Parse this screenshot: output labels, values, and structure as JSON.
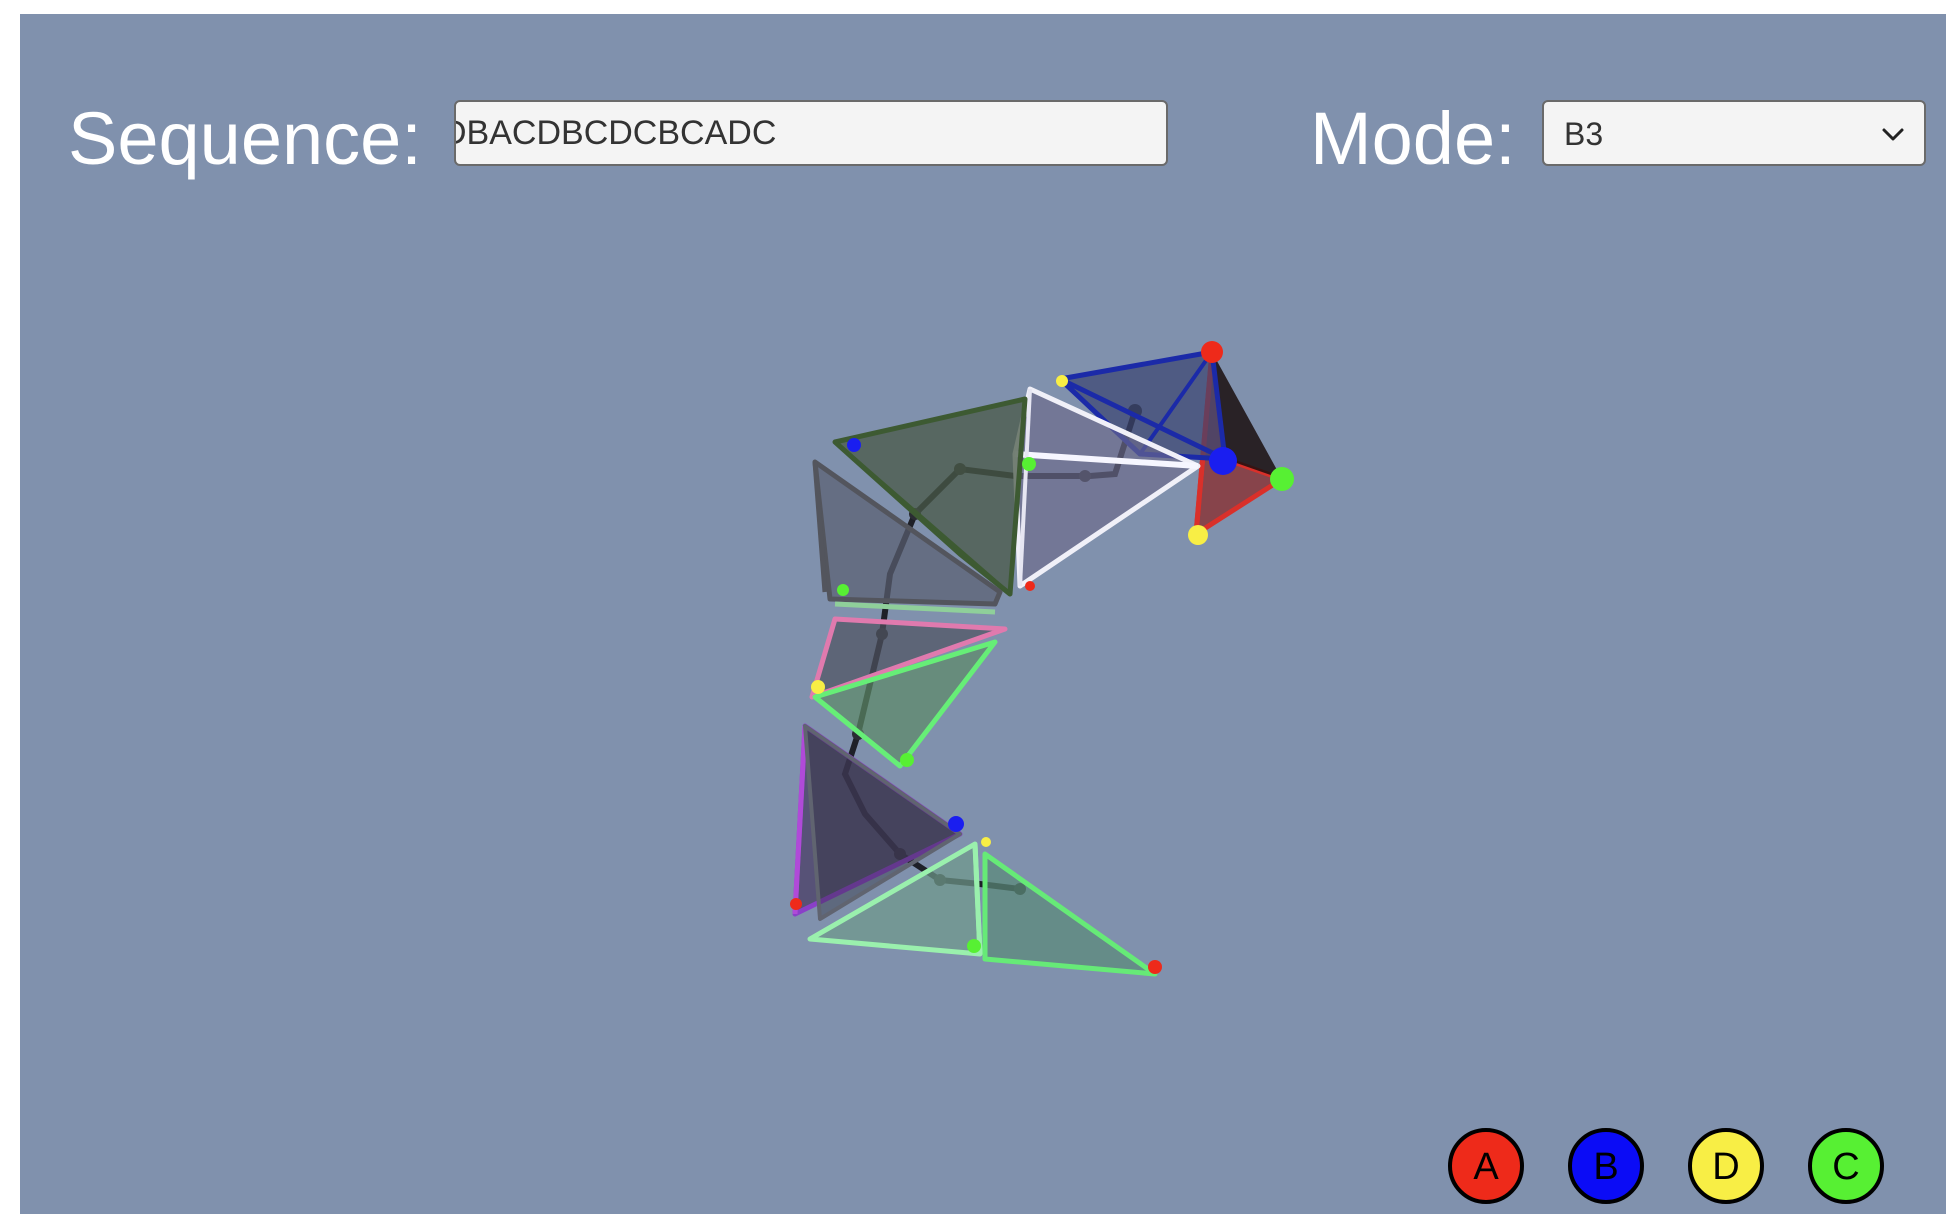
{
  "sequence": {
    "label": "Sequence:",
    "value": "DBACDBCDCBCADC"
  },
  "mode": {
    "label": "Mode:",
    "selected": "B3"
  },
  "buttons": [
    {
      "label": "A",
      "color": "#ee2a1a"
    },
    {
      "label": "B",
      "color": "#0b0cf6"
    },
    {
      "label": "D",
      "color": "#f8ee45"
    },
    {
      "label": "C",
      "color": "#57f033"
    }
  ],
  "scene": {
    "background_color": "#8091ad",
    "vertex_colors": {
      "A": "#ee2a1a",
      "B": "#0b0cf6",
      "C": "#57f033",
      "D": "#f8ee45"
    }
  }
}
